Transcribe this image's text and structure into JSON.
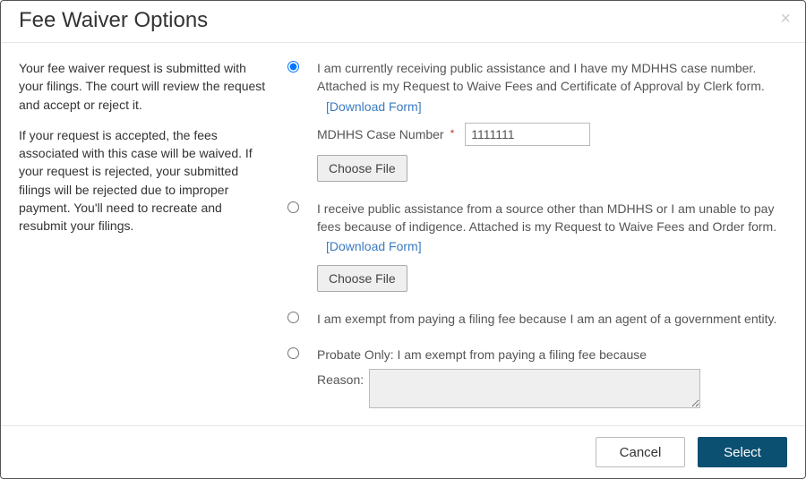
{
  "modal": {
    "title": "Fee Waiver Options",
    "close_glyph": "×"
  },
  "intro": {
    "p1": "Your fee waiver request is submitted with your filings. The court will review the request and accept or reject it.",
    "p2": "If your request is accepted, the fees associated with this case will be waived. If your request is rejected, your submitted filings will be rejected due to  improper payment. You'll need to recreate and resubmit your filings."
  },
  "options": {
    "opt1": {
      "text": "I am currently receiving public assistance and I have my MDHHS case number. Attached is my Request to Waive Fees and Certificate of Approval by Clerk form.",
      "download": "[Download Form]",
      "case_label": "MDHHS Case Number",
      "case_value": "1111111",
      "choose_file": "Choose File"
    },
    "opt2": {
      "text": "I receive public assistance from a source other than MDHHS or I am unable to pay fees because of indigence. Attached is my Request to Waive Fees and Order form.",
      "download": "[Download Form]",
      "choose_file": "Choose File"
    },
    "opt3": {
      "text": "I am exempt from paying a filing fee because I am an agent of a government entity."
    },
    "opt4": {
      "text": "Probate Only: I am exempt from paying a filing fee because",
      "reason_label": "Reason:",
      "reason_value": ""
    }
  },
  "footer": {
    "cancel": "Cancel",
    "select": "Select"
  },
  "required_marker": "*"
}
